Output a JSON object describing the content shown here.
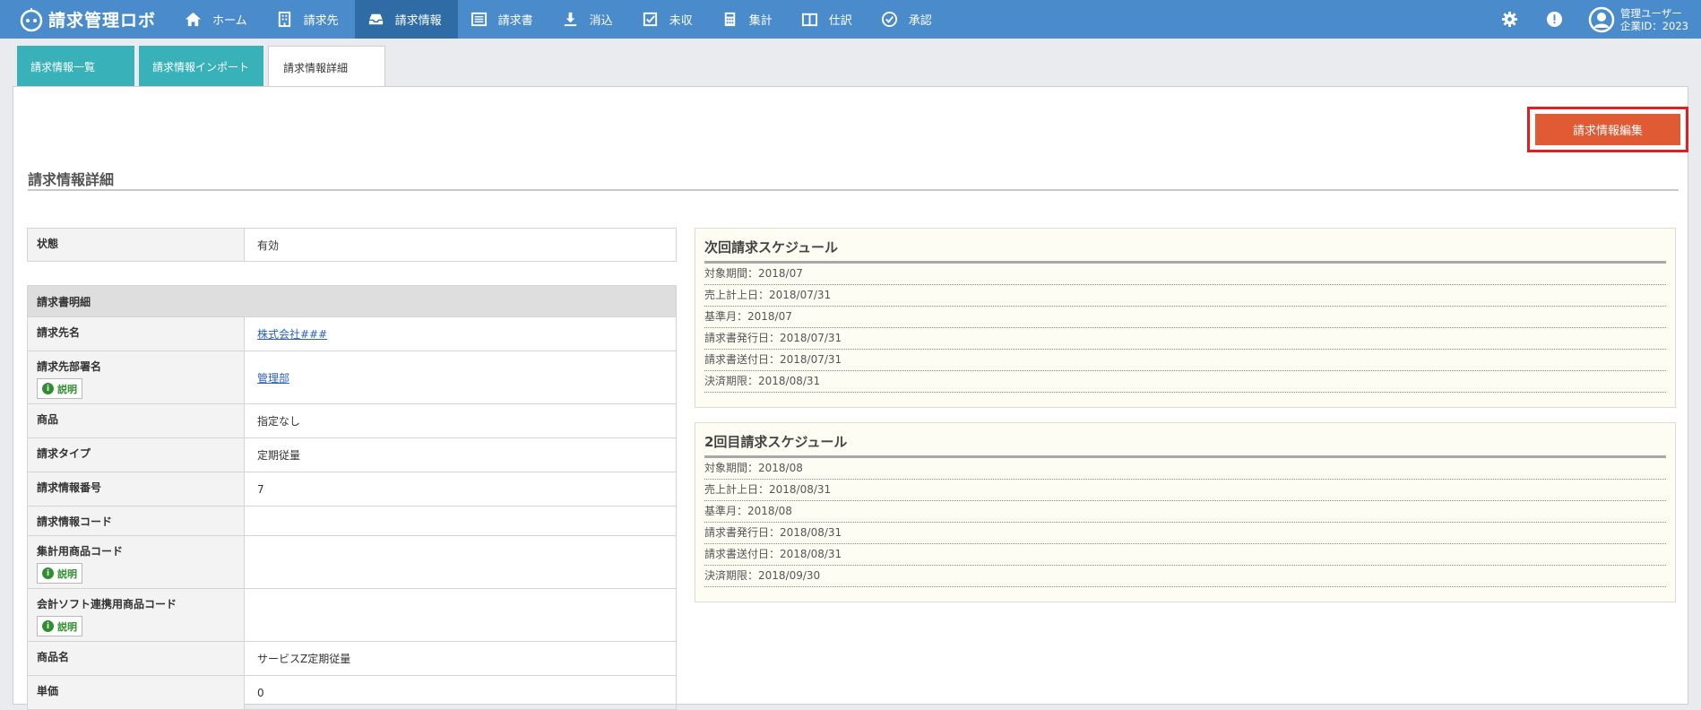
{
  "app": {
    "name": "請求管理ロボ"
  },
  "nav": {
    "items": [
      {
        "label": "ホーム",
        "icon": "home-icon"
      },
      {
        "label": "請求先",
        "icon": "building-icon"
      },
      {
        "label": "請求情報",
        "icon": "inbox-icon"
      },
      {
        "label": "請求書",
        "icon": "list-icon"
      },
      {
        "label": "消込",
        "icon": "download-icon"
      },
      {
        "label": "未収",
        "icon": "checkbox-icon"
      },
      {
        "label": "集計",
        "icon": "calculator-icon"
      },
      {
        "label": "仕訳",
        "icon": "book-icon"
      },
      {
        "label": "承認",
        "icon": "check-circle-icon"
      }
    ],
    "active_index": 2
  },
  "user": {
    "name": "管理ユーザー",
    "company": "企業ID：2023"
  },
  "tabs": [
    {
      "label": "請求情報一覧"
    },
    {
      "label": "請求情報インポート"
    },
    {
      "label": "請求情報詳細"
    }
  ],
  "edit_button": "請求情報編集",
  "page_title": "請求情報詳細",
  "status": {
    "label": "状態",
    "value": "有効"
  },
  "invoice_section": "請求書明細",
  "help_label": "説明",
  "details": {
    "client_name": {
      "label": "請求先名",
      "value": "株式会社###"
    },
    "department": {
      "label": "請求先部署名",
      "value": "管理部"
    },
    "product": {
      "label": "商品",
      "value": "指定なし"
    },
    "billing_type": {
      "label": "請求タイプ",
      "value": "定期従量"
    },
    "billing_number": {
      "label": "請求情報番号",
      "value": "7"
    },
    "billing_code": {
      "label": "請求情報コード",
      "value": ""
    },
    "agg_product_code": {
      "label": "集計用商品コード",
      "value": ""
    },
    "acct_product_code": {
      "label": "会計ソフト連携用商品コード",
      "value": ""
    },
    "product_name": {
      "label": "商品名",
      "value": "サービスZ定期従量"
    },
    "unit_price": {
      "label": "単価",
      "value": "0"
    }
  },
  "schedule_next": {
    "title": "次回請求スケジュール",
    "items": [
      "対象期間：2018/07",
      "売上計上日：2018/07/31",
      "基準月：2018/07",
      "請求書発行日：2018/07/31",
      "請求書送付日：2018/07/31",
      "決済期限：2018/08/31"
    ]
  },
  "schedule_second": {
    "title": "2回目請求スケジュール",
    "items": [
      "対象期間：2018/08",
      "売上計上日：2018/08/31",
      "基準月：2018/08",
      "請求書発行日：2018/08/31",
      "請求書送付日：2018/08/31",
      "決済期限：2018/09/30"
    ]
  }
}
